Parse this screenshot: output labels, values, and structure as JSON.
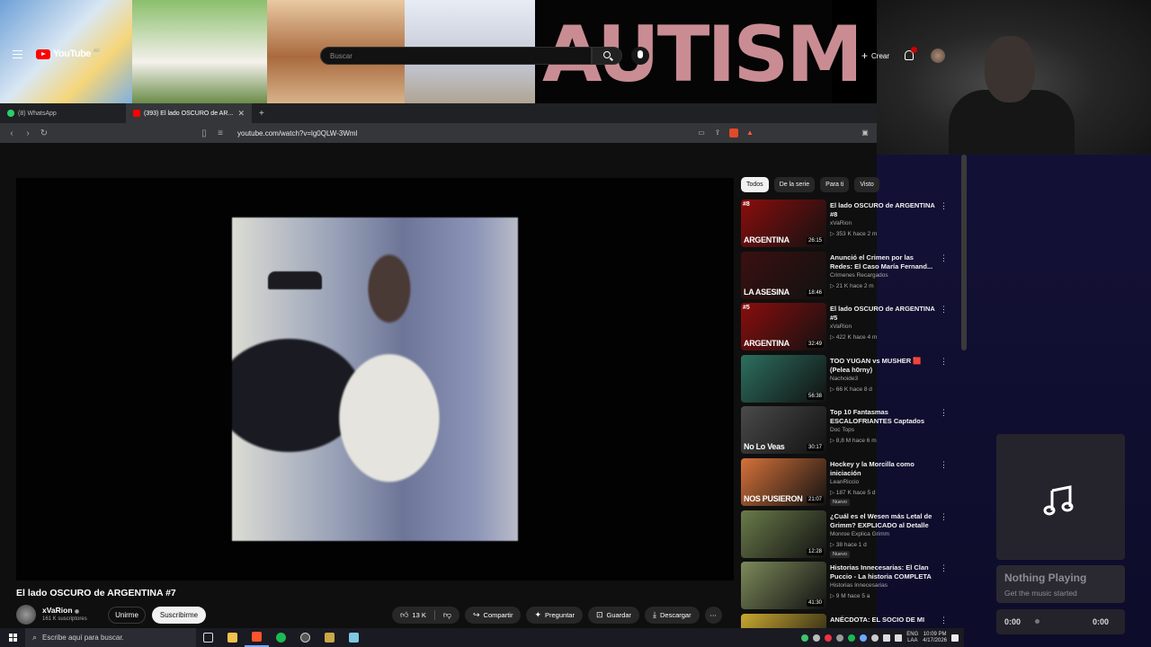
{
  "overlay": {
    "banner_word": "AUTISM"
  },
  "browser": {
    "tabs": [
      {
        "label": "(8) WhatsApp",
        "favicon_color": "#25d366",
        "active": false
      },
      {
        "label": "(393) El lado OSCURO de AR...",
        "favicon_color": "#ff0000",
        "active": true
      }
    ],
    "new_tab": "+",
    "url": "youtube.com/watch?v=lg0QLW-3Wml"
  },
  "youtube": {
    "logo": "YouTube",
    "country_code": "AR",
    "search_placeholder": "Buscar",
    "create_label": "Crear",
    "video": {
      "title": "El lado OSCURO de ARGENTINA #7",
      "channel": "xVaRion",
      "subscribers": "161 K suscriptores",
      "join_label": "Unirme",
      "subscribe_label": "Suscribirme",
      "likes": "13 K",
      "share_label": "Compartir",
      "ask_label": "Preguntar",
      "save_label": "Guardar",
      "download_label": "Descargar"
    },
    "chips": [
      "Todos",
      "De la serie",
      "Para ti",
      "Visto"
    ],
    "recommendations": [
      {
        "title": "El lado OSCURO de ARGENTINA #8",
        "channel": "xVaRion",
        "meta": "▷ 353 K  hace 2 m",
        "duration": "26:15",
        "thumb_label": "ARGENTINA",
        "thumb_num": "#8",
        "is_new": false,
        "thumb_color": "#8b0d0d"
      },
      {
        "title": "Anunció el Crimen por las Redes: El Caso María Fernand...",
        "channel": "Crimenes Recargados",
        "meta": "▷ 21 K  hace 2 m",
        "duration": "18:46",
        "thumb_label": "LA ASESINA",
        "thumb_num": "",
        "is_new": false,
        "thumb_color": "#3b1010"
      },
      {
        "title": "El lado OSCURO de ARGENTINA #5",
        "channel": "xVaRion",
        "meta": "▷ 422 K  hace 4 m",
        "duration": "32:49",
        "thumb_label": "ARGENTINA",
        "thumb_num": "#5",
        "is_new": false,
        "thumb_color": "#8b0d0d"
      },
      {
        "title": "TOO YUGAN vs MUSHER 🟥 (Pelea h0rny)",
        "channel": "Nachoide3",
        "meta": "▷ 66 K  hace 8 d",
        "duration": "56:38",
        "thumb_label": "",
        "thumb_num": "",
        "is_new": false,
        "thumb_color": "#2c6f5f"
      },
      {
        "title": "Top 10 Fantasmas ESCALOFRIANTES Captados E...",
        "channel": "Doc Tops",
        "meta": "▷ 8,8 M  hace 6 m",
        "duration": "30:17",
        "thumb_label": "No Lo Veas",
        "thumb_num": "",
        "is_new": false,
        "thumb_color": "#4a4a4a"
      },
      {
        "title": "Hockey y la Morcilla como iniciación",
        "channel": "LeanRiccio",
        "meta": "▷ 187 K  hace 5 d",
        "duration": "21:07",
        "thumb_label": "NOS PUSIERON",
        "thumb_num": "",
        "is_new": true,
        "thumb_color": "#d5723a"
      },
      {
        "title": "¿Cuál es el Wesen más Letal de Grimm? EXPLICADO al Detalle",
        "channel": "Monroe Explica Grimm",
        "meta": "▷ 38  hace 1 d",
        "duration": "12:28",
        "thumb_label": "",
        "thumb_num": "",
        "is_new": true,
        "thumb_color": "#6a7b4a"
      },
      {
        "title": "Historias Innecesarias: El Clan Puccio - La historia COMPLETA",
        "channel": "Historias Innecesarias",
        "meta": "▷ 9 M  hace 5 a",
        "duration": "41:30",
        "thumb_label": "",
        "thumb_num": "",
        "is_new": false,
        "thumb_color": "#7c8a5a"
      },
      {
        "title": "ANÉCDOTA: EL SOCIO DE MI",
        "channel": "",
        "meta": "",
        "duration": "",
        "thumb_label": "",
        "thumb_num": "",
        "is_new": false,
        "thumb_color": "#c9a830"
      }
    ],
    "new_badge": "Nuevo"
  },
  "music": {
    "title": "Nothing Playing",
    "subtitle": "Get the music started",
    "time_start": "0:00",
    "time_end": "0:00"
  },
  "taskbar": {
    "search_placeholder": "Escribe aquí para buscar.",
    "lang": "ENG",
    "lang2": "LAA",
    "time": "10:09 PM",
    "date": "4/17/2026"
  }
}
